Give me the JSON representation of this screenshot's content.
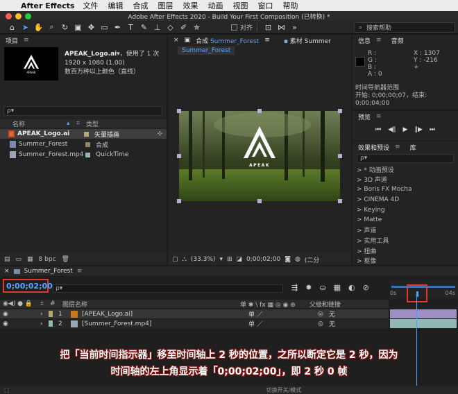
{
  "menubar": {
    "app_name": "After Effects",
    "items": [
      "文件",
      "编辑",
      "合成",
      "图层",
      "效果",
      "动画",
      "视图",
      "窗口",
      "帮助"
    ]
  },
  "window": {
    "title": "Adobe After Effects 2020 - Build Your First Composition (已转换) *"
  },
  "toolbar": {
    "snap_label": "对齐",
    "search_help": "搜索帮助"
  },
  "project": {
    "tab_label": "项目",
    "selected_file": "APEAK_Logo.ai",
    "used_text": "▾，使用了 1 次",
    "dimensions": "1920 x 1080 (1.00)",
    "color_info": "数百万种以上颜色（直线）",
    "search_placeholder": "ρ▾",
    "col_name": "名称",
    "col_type": "类型",
    "files": [
      {
        "name": "APEAK_Logo.ai",
        "type": "矢量插画",
        "swatch": "#b5a77a"
      },
      {
        "name": "Summer_Forest",
        "type": "合成",
        "swatch": "#8f8a66"
      },
      {
        "name": "Summer_Forest.mp4",
        "type": "QuickTime",
        "swatch": "#8fb7b4"
      }
    ],
    "bpc": "8 bpc"
  },
  "composition": {
    "tab_prefix": "合成",
    "tab_name": "Summer_Forest",
    "footage_tab": "素材 Summer",
    "subtab": "Summer_Forest",
    "logo_text": "APEAK",
    "zoom": "(33.3%)",
    "timecode": "0;00;02;00",
    "quality": "(二分"
  },
  "info": {
    "tab_info": "信息",
    "tab_audio": "音频",
    "r": "R :",
    "g": "G :",
    "b": "B :",
    "a": "A : 0",
    "x": "X : 1307",
    "y": "Y : -216",
    "nav_label": "时间导航器范围",
    "nav_range": "开始: 0;00;00;07，结束: 0;00;04;00"
  },
  "preview": {
    "tab_label": "预览"
  },
  "effects": {
    "tab_label": "效果和预设",
    "tab_lib": "库",
    "search_placeholder": "ρ▾",
    "items": [
      "> * 动画预设",
      "> 3D 声道",
      "> Boris FX Mocha",
      "> CINEMA 4D",
      "> Keying",
      "> Matte",
      "> 声道",
      "> 实用工具",
      "> 扭曲",
      "> 抠像"
    ]
  },
  "timeline": {
    "tab_label": "Summer_Forest",
    "timecode": "0;00;02;00",
    "search_placeholder": "ρ▾",
    "col_layer_name": "图层名称",
    "col_switches": "单 ✱ \\ fx ▦ ◎ ◉ ⊕",
    "col_parent": "父级和链接",
    "ruler_start": "0s",
    "ruler_end": "04s",
    "layers": [
      {
        "num": "1",
        "name": "[APEAK_Logo.ai]",
        "parent": "无"
      },
      {
        "num": "2",
        "name": "[Summer_Forest.mp4]",
        "parent": "无"
      }
    ],
    "footer_label": "切换开关/模式"
  },
  "caption": {
    "line1": "把「当前时间指示器」移至时间轴上 2 秒的位置，之所以断定它是 2 秒，因为",
    "line2": "时间轴的左上角显示着「0;00;02;00」，即 2 秒 0 帧"
  }
}
